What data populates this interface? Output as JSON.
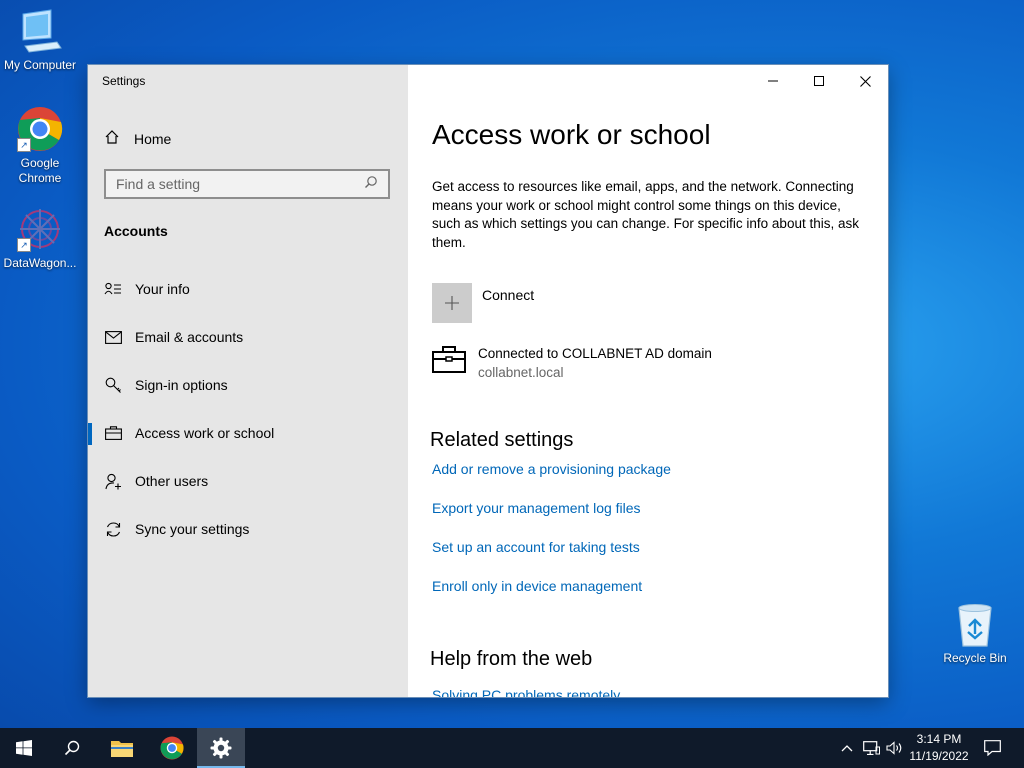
{
  "desktop": {
    "icons": [
      {
        "label": "My Computer"
      },
      {
        "label": "Google Chrome"
      },
      {
        "label": "DataWagon..."
      }
    ],
    "recycle_bin": "Recycle Bin"
  },
  "window": {
    "title": "Settings",
    "sidebar": {
      "home": "Home",
      "search_placeholder": "Find a setting",
      "section": "Accounts",
      "items": [
        {
          "label": "Your info",
          "icon": "person-card-icon"
        },
        {
          "label": "Email & accounts",
          "icon": "mail-icon"
        },
        {
          "label": "Sign-in options",
          "icon": "key-icon"
        },
        {
          "label": "Access work or school",
          "icon": "briefcase-icon",
          "active": true
        },
        {
          "label": "Other users",
          "icon": "add-person-icon"
        },
        {
          "label": "Sync your settings",
          "icon": "sync-icon"
        }
      ]
    },
    "main": {
      "title": "Access work or school",
      "description": "Get access to resources like email, apps, and the network. Connecting means your work or school might control some things on this device, such as which settings you can change. For specific info about this, ask them.",
      "connect_label": "Connect",
      "account": {
        "title": "Connected to COLLABNET AD domain",
        "subtitle": "collabnet.local"
      },
      "related_heading": "Related settings",
      "related_links": [
        "Add or remove a provisioning package",
        "Export your management log files",
        "Set up an account for taking tests",
        "Enroll only in device management"
      ],
      "help_heading": "Help from the web",
      "help_link": "Solving PC problems remotely"
    }
  },
  "taskbar": {
    "time": "3:14 PM",
    "date": "11/19/2022"
  },
  "colors": {
    "accent": "#0067c0",
    "link": "#0067b8",
    "sidebar_bg": "#e6e6e6",
    "taskbar_bg": "#0f1a2a"
  }
}
